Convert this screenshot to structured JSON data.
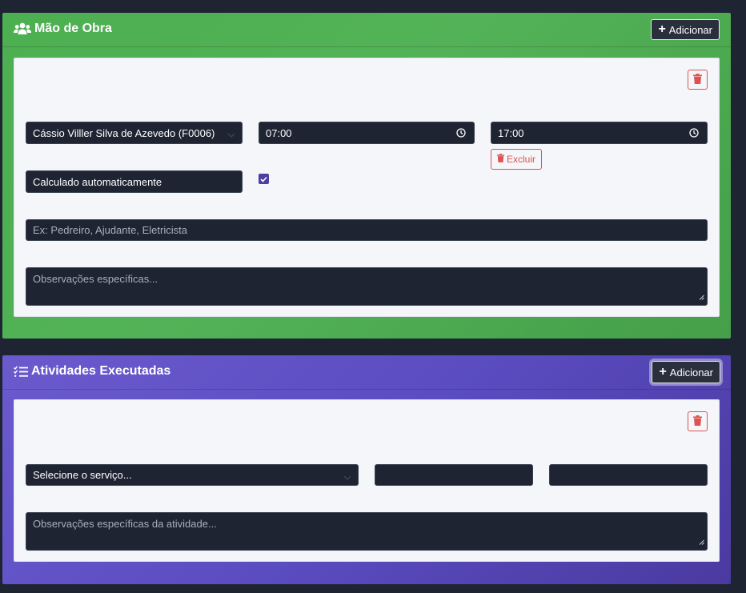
{
  "labor": {
    "title": "Mão de Obra",
    "add_label": "Adicionar",
    "worker_select": "Cássio Villler Silva de Azevedo (F0006)",
    "start_time": "07:00",
    "end_time": "17:00",
    "delete_label": "Excluir",
    "hours_field": "Calculado automaticamente",
    "auto_calc_checked": true,
    "role_placeholder": "Ex: Pedreiro, Ajudante, Eletricista",
    "notes_placeholder": "Observações específicas..."
  },
  "activities": {
    "title": "Atividades Executadas",
    "add_label": "Adicionar",
    "service_select": "Selecione o serviço...",
    "quantity_value": "",
    "unit_value": "",
    "notes_placeholder": "Observações específicas da atividade..."
  },
  "colors": {
    "labor_header": "#4caf50",
    "activities_header": "#6a5acd",
    "danger": "#e05252",
    "input_bg": "#1f2433"
  }
}
